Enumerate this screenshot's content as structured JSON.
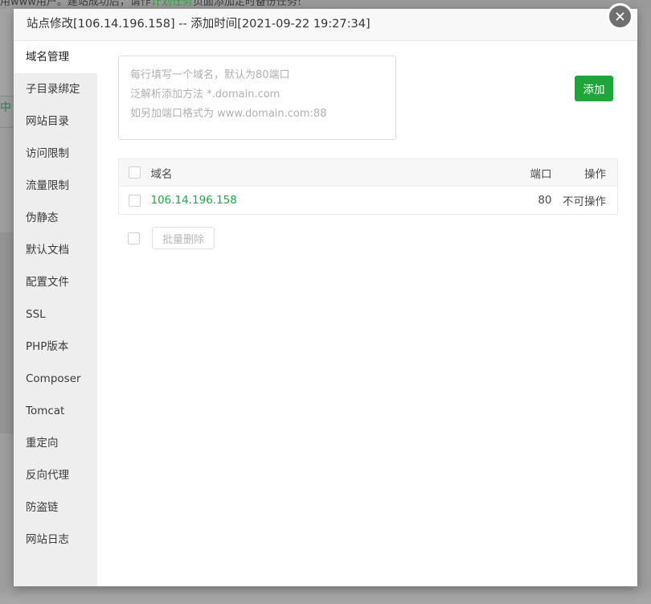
{
  "background": {
    "notice_text_prefix": "用www用户。建站成功后，请作",
    "notice_link": "计划任务",
    "notice_text_suffix": "页面添加定时备份任务!",
    "side_glyph": "中"
  },
  "modal": {
    "title": "站点修改[106.14.196.158] -- 添加时间[2021-09-22 19:27:34]",
    "close_icon": "close-icon"
  },
  "sidebar": {
    "items": [
      {
        "label": "域名管理",
        "active": true
      },
      {
        "label": "子目录绑定",
        "active": false
      },
      {
        "label": "网站目录",
        "active": false
      },
      {
        "label": "访问限制",
        "active": false
      },
      {
        "label": "流量限制",
        "active": false
      },
      {
        "label": "伪静态",
        "active": false
      },
      {
        "label": "默认文档",
        "active": false
      },
      {
        "label": "配置文件",
        "active": false
      },
      {
        "label": "SSL",
        "active": false
      },
      {
        "label": "PHP版本",
        "active": false
      },
      {
        "label": "Composer",
        "active": false
      },
      {
        "label": "Tomcat",
        "active": false
      },
      {
        "label": "重定向",
        "active": false
      },
      {
        "label": "反向代理",
        "active": false
      },
      {
        "label": "防盗链",
        "active": false
      },
      {
        "label": "网站日志",
        "active": false
      }
    ]
  },
  "content": {
    "textarea": {
      "value": "",
      "placeholder": "每行填写一个域名，默认为80端口\n泛解析添加方法 *.domain.com\n如另加端口格式为 www.domain.com:88"
    },
    "add_button_label": "添加",
    "table": {
      "headers": {
        "domain": "域名",
        "port": "端口",
        "action": "操作"
      },
      "rows": [
        {
          "domain": "106.14.196.158",
          "port": "80",
          "action": "不可操作"
        }
      ]
    },
    "batch_delete_label": "批量删除"
  },
  "colors": {
    "accent_green": "#20a53a",
    "link_green": "#22a745",
    "sidebar_bg": "#eeeeee",
    "header_bg": "#f8f8f8"
  }
}
